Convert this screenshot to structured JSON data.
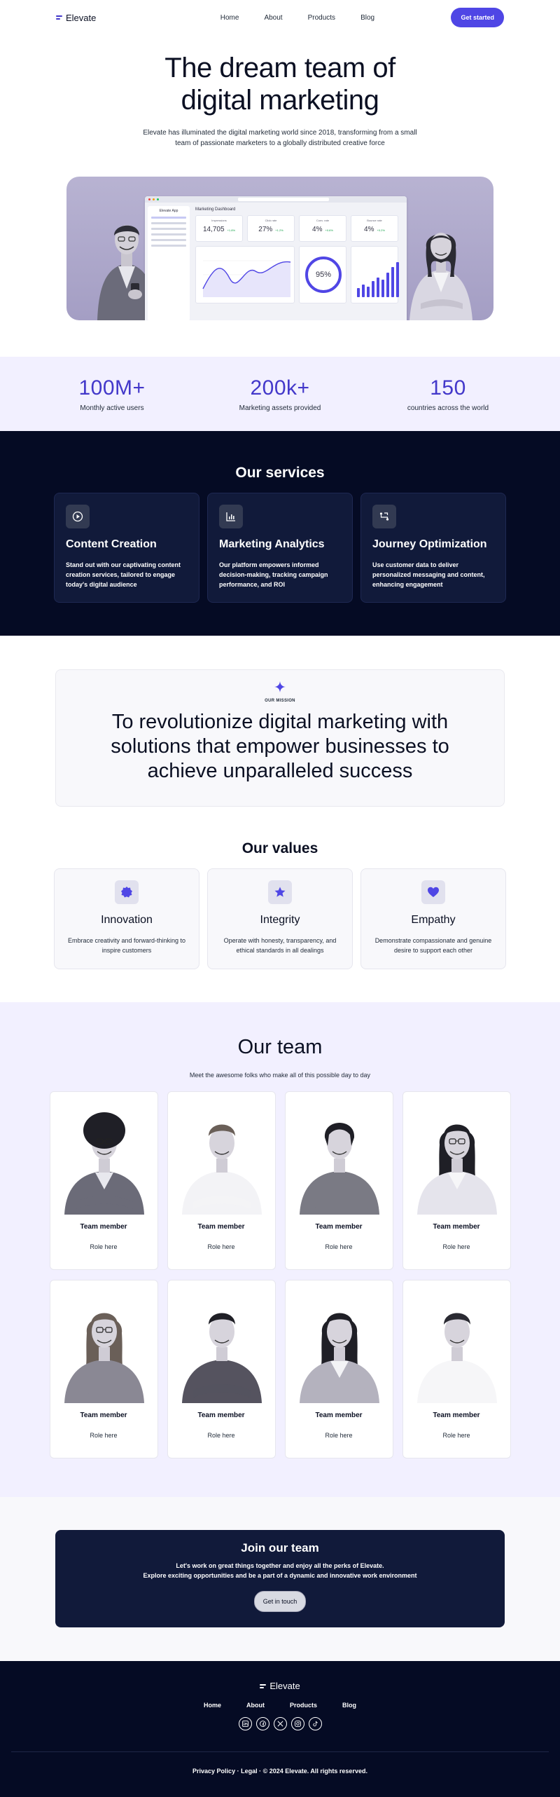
{
  "nav": {
    "brand": "Elevate",
    "links": [
      "Home",
      "About",
      "Products",
      "Blog"
    ],
    "cta": "Get started"
  },
  "hero": {
    "title_line1": "The dream team of",
    "title_line2": "digital marketing",
    "subtitle": "Elevate has illuminated the digital marketing world since 2018, transforming from a small team of passionate marketers to a globally distributed creative force",
    "dashboard": {
      "brand": "Elevate App",
      "title": "Marketing Dashboard",
      "kpis": [
        {
          "label": "Impressions",
          "value": "14,705",
          "delta": "+1.8%"
        },
        {
          "label": "Click rate",
          "value": "27%",
          "delta": "+1.2%"
        },
        {
          "label": "Conv. rate",
          "value": "4%",
          "delta": "+0.6%"
        },
        {
          "label": "Bounce rate",
          "value": "4%",
          "delta": "+0.2%"
        }
      ],
      "ring_value": "95%",
      "bar_values": [
        0.25,
        0.35,
        0.3,
        0.45,
        0.55,
        0.5,
        0.7,
        0.85,
        1.0
      ]
    }
  },
  "stats": [
    {
      "value": "100M+",
      "label": "Monthly active users"
    },
    {
      "value": "200k+",
      "label": "Marketing assets provided"
    },
    {
      "value": "150",
      "label": "countries across the world"
    }
  ],
  "services": {
    "title": "Our services",
    "items": [
      {
        "icon": "play-icon",
        "title": "Content Creation",
        "text": "Stand out with our captivating content creation services, tailored to engage today's digital audience"
      },
      {
        "icon": "bar-chart-icon",
        "title": "Marketing Analytics",
        "text": "Our platform empowers informed decision-making, tracking campaign performance, and ROI"
      },
      {
        "icon": "journey-icon",
        "title": "Journey Optimization",
        "text": "Use customer data to deliver personalized messaging and content, enhancing engagement"
      }
    ]
  },
  "mission": {
    "kicker": "OUR MISSION",
    "line1": "To revolutionize digital marketing with",
    "line2": "solutions that empower businesses to",
    "line3": "achieve unparalleled success"
  },
  "values": {
    "title": "Our values",
    "items": [
      {
        "icon": "badge-icon",
        "title": "Innovation",
        "text": "Embrace creativity and forward-thinking to inspire customers"
      },
      {
        "icon": "star-icon",
        "title": "Integrity",
        "text": "Operate with honesty, transparency, and ethical standards in all dealings"
      },
      {
        "icon": "heart-icon",
        "title": "Empathy",
        "text": "Demonstrate compassionate and genuine desire to support each other"
      }
    ],
    "icon_color": "#4f46e5"
  },
  "team": {
    "title": "Our team",
    "subtitle": "Meet the awesome folks who make all of this possible day to day",
    "members": [
      {
        "name": "Team member",
        "role": "Role here"
      },
      {
        "name": "Team member",
        "role": "Role here"
      },
      {
        "name": "Team member",
        "role": "Role here"
      },
      {
        "name": "Team member",
        "role": "Role here"
      },
      {
        "name": "Team member",
        "role": "Role here"
      },
      {
        "name": "Team member",
        "role": "Role here"
      },
      {
        "name": "Team member",
        "role": "Role here"
      },
      {
        "name": "Team member",
        "role": "Role here"
      }
    ]
  },
  "join": {
    "title": "Join our team",
    "line1": "Let's work on great things together and enjoy all the perks of Elevate.",
    "line2": "Explore exciting opportunities and be a part of a dynamic and innovative work environment",
    "cta": "Get in touch"
  },
  "footer": {
    "brand": "Elevate",
    "links": [
      "Home",
      "About",
      "Products",
      "Blog"
    ],
    "socials": [
      "linkedin-icon",
      "facebook-icon",
      "x-icon",
      "instagram-icon",
      "tiktok-icon"
    ],
    "legal": "Privacy Policy · Legal · © 2024 Elevate. All rights reserved."
  },
  "colors": {
    "accent": "#4f46e5",
    "stat_text": "#4338ca",
    "dark_bg": "#050b24",
    "card_dark": "#111a3a",
    "lavender_bg": "#f2f0ff"
  }
}
